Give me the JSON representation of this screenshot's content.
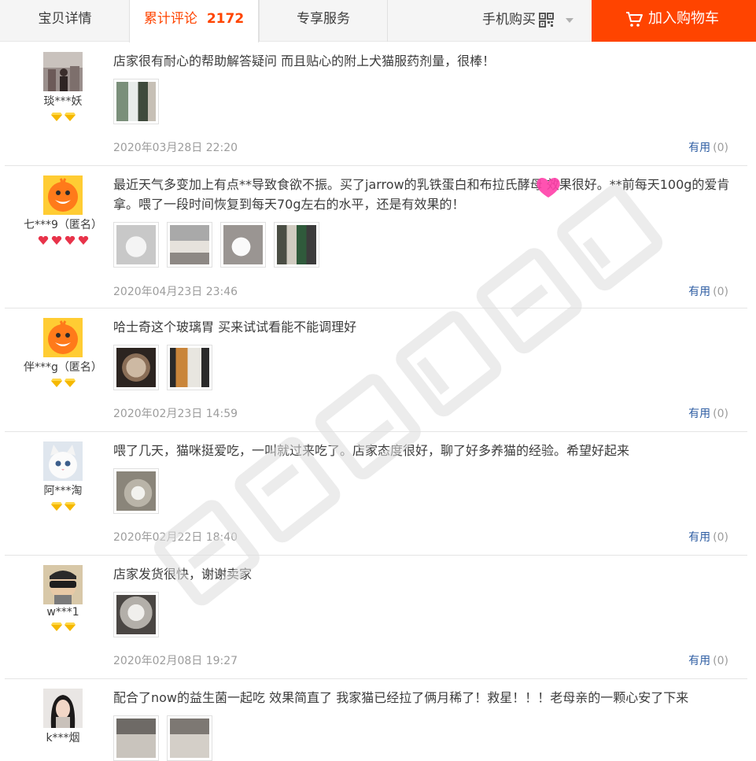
{
  "tabs": [
    {
      "label": "宝贝详情"
    },
    {
      "label": "累计评论",
      "count": "2172"
    },
    {
      "label": "专享服务"
    }
  ],
  "mobile_buy_label": "手机购买",
  "add_to_cart_label": "加入购物车",
  "useful_label": "有用",
  "reviews": [
    {
      "nick": "琰***妖",
      "text": "店家很有耐心的帮助解答疑问 而且贴心的附上犬猫服药剂量，很棒！",
      "date": "2020年03月28日 22:20",
      "useful_count": "(0)"
    },
    {
      "nick": "七***9（匿名）",
      "text": "最近天气多变加上有点**导致食欲不振。买了jarrow的乳铁蛋白和布拉氏酵母 效果很好。**前每天100g的爱肯拿。喂了一段时间恢复到每天70g左右的水平，还是有效果的！",
      "date": "2020年04月23日 23:46",
      "useful_count": "(0)"
    },
    {
      "nick": "伴***g（匿名）",
      "text": "哈士奇这个玻璃胃 买来试试看能不能调理好",
      "date": "2020年02月23日 14:59",
      "useful_count": "(0)"
    },
    {
      "nick": "阿***淘",
      "text": "喂了几天，猫咪挺爱吃，一叫就过来吃了。店家态度很好，聊了好多养猫的经验。希望好起来",
      "date": "2020年02月22日 18:40",
      "useful_count": "(0)"
    },
    {
      "nick": "w***1",
      "text": "店家发货很快，谢谢卖家",
      "date": "2020年02月08日 19:27",
      "useful_count": "(0)"
    },
    {
      "nick": "k***烟",
      "text": "配合了now的益生菌一起吃 效果简直了 我家猫已经拉了俩月稀了！救星！！！老母亲的一颗心安了下来",
      "date": "",
      "useful_count": ""
    }
  ],
  "colors": {
    "accent": "#ff4400",
    "link": "#2f5ea3",
    "gold_gem": "#f5b800",
    "red_gem": "#e8334a"
  }
}
